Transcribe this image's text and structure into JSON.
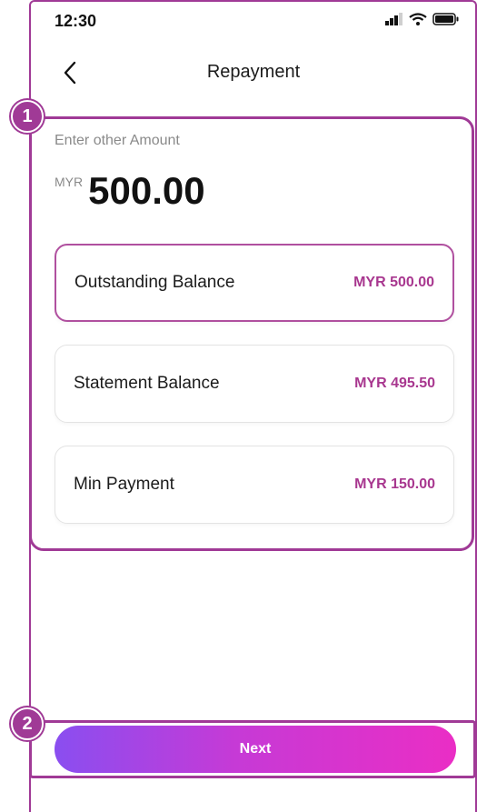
{
  "status_bar": {
    "time": "12:30",
    "icons": [
      "signal-icon",
      "wifi-icon",
      "battery-icon"
    ]
  },
  "nav": {
    "back_icon": "chevron-left-icon",
    "title": "Repayment"
  },
  "amount": {
    "label": "Enter other Amount",
    "currency": "MYR",
    "value": "500.00"
  },
  "options": [
    {
      "label": "Outstanding Balance",
      "amount": "MYR 500.00",
      "selected": true
    },
    {
      "label": "Statement Balance",
      "amount": "MYR 495.50",
      "selected": false
    },
    {
      "label": "Min Payment",
      "amount": "MYR 150.00",
      "selected": false
    }
  ],
  "annotations": {
    "badge_1": "1",
    "badge_2": "2"
  },
  "footer": {
    "next_label": "Next"
  },
  "colors": {
    "accent": "#a03a96",
    "amount_text": "#a8378f",
    "button_gradient_start": "#8a4ef0",
    "button_gradient_end": "#ea2ec5"
  }
}
